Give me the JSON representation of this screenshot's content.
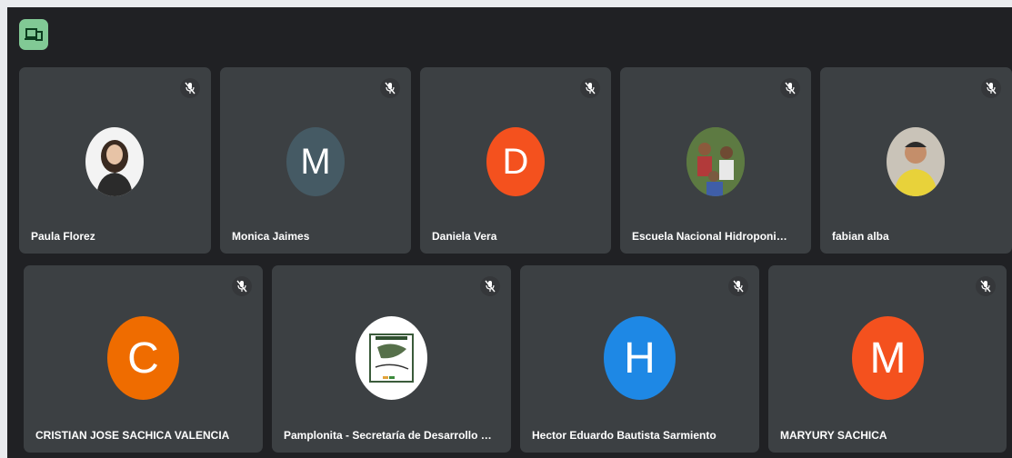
{
  "participants": [
    {
      "name": "Paula Florez",
      "avatar_type": "photo",
      "photo_icon": "person-photo-icon"
    },
    {
      "name": "Monica Jaimes",
      "avatar_type": "letter",
      "initial": "M",
      "color": "#455a64"
    },
    {
      "name": "Daniela Vera",
      "avatar_type": "letter",
      "initial": "D",
      "color": "#f4511e"
    },
    {
      "name": "Escuela Nacional Hidroponia Y A...",
      "avatar_type": "photo",
      "photo_icon": "group-photo-icon"
    },
    {
      "name": "fabian alba",
      "avatar_type": "photo",
      "photo_icon": "person-photo-icon"
    },
    {
      "name": "CRISTIAN JOSE SACHICA VALENCIA",
      "avatar_type": "letter",
      "initial": "C",
      "color": "#ef6c00"
    },
    {
      "name": "Pamplonita - Secretaría de Desarrollo Pro...",
      "avatar_type": "photo",
      "photo_icon": "logo-icon"
    },
    {
      "name": "Hector Eduardo Bautista Sarmiento",
      "avatar_type": "letter",
      "initial": "H",
      "color": "#1e88e5"
    },
    {
      "name": "MARYURY SACHICA",
      "avatar_type": "letter",
      "initial": "M",
      "color": "#f4511e"
    }
  ],
  "icons": {
    "top": "devices-icon",
    "mute": "mic-off-icon"
  },
  "colors": {
    "background": "#202124",
    "tile": "#3c4043",
    "top_icon_bg": "#81c995"
  }
}
